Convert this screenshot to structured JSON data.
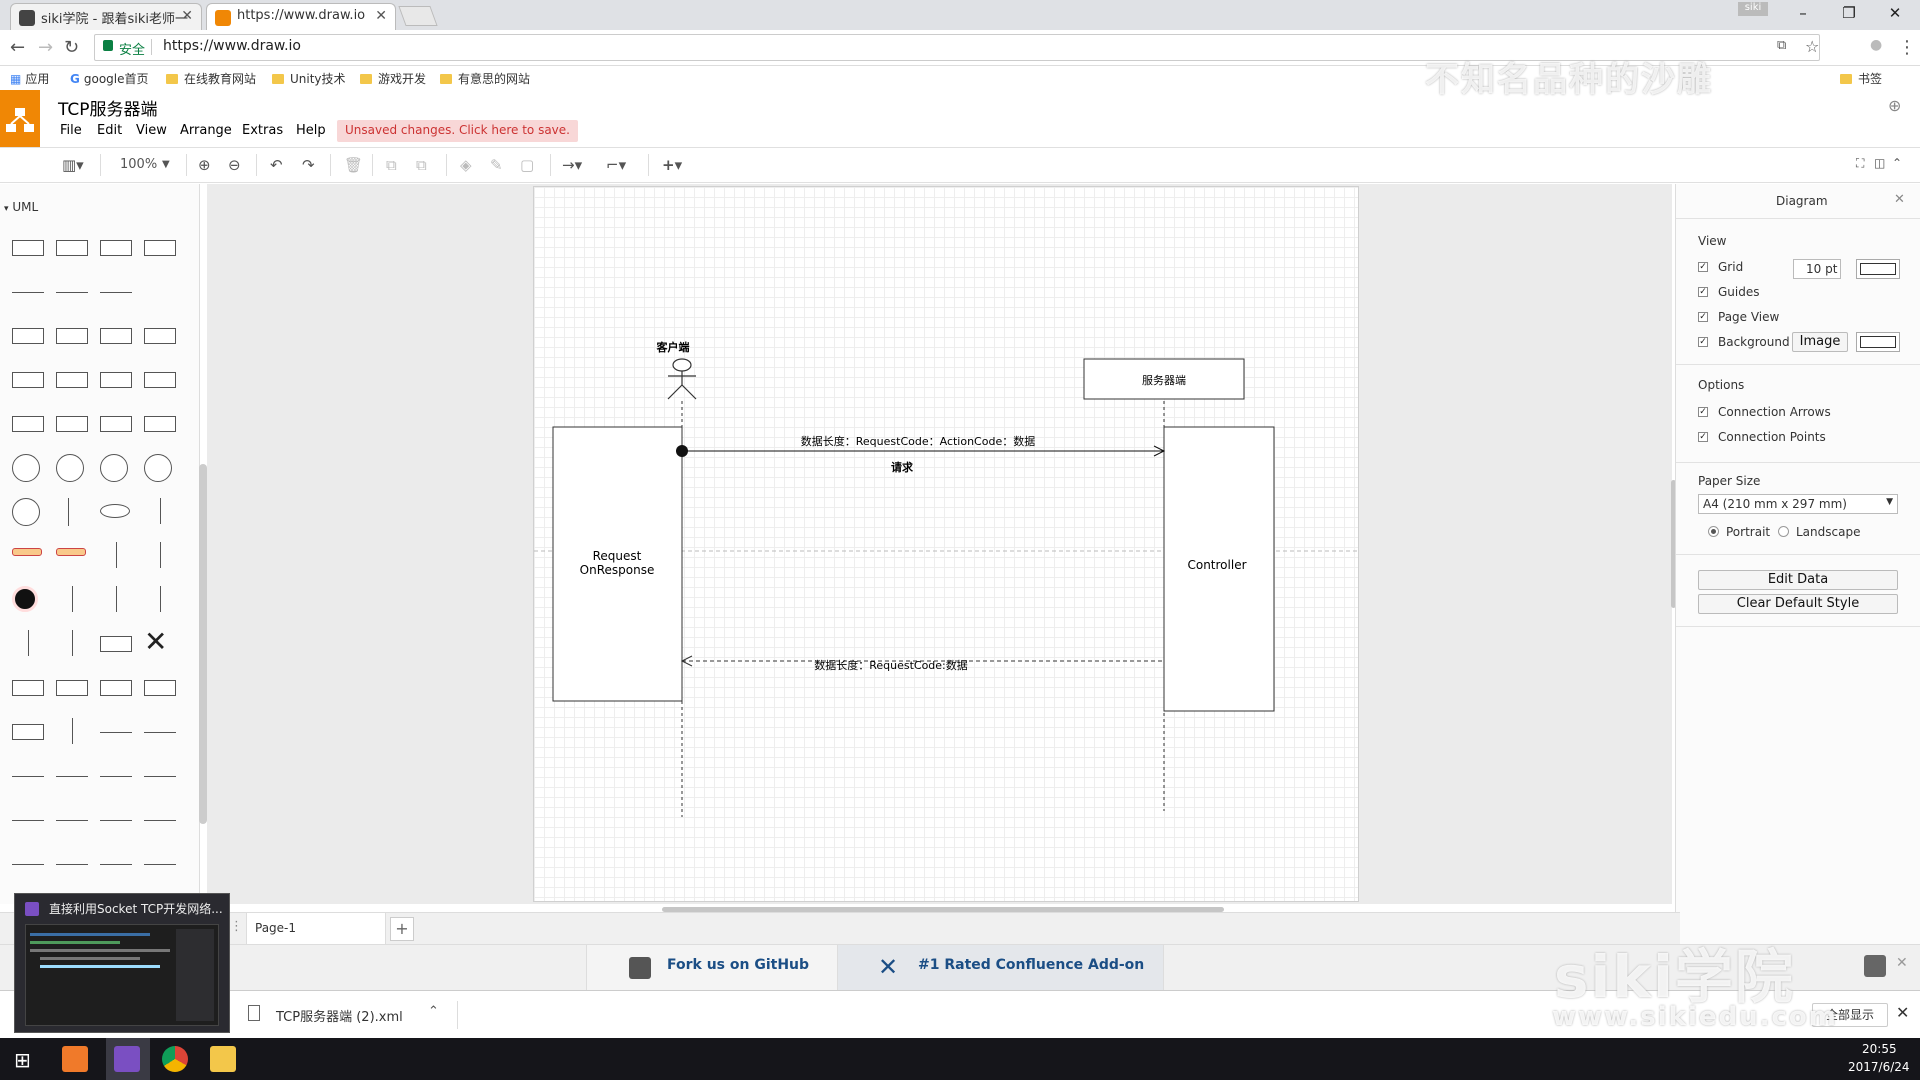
{
  "browser": {
    "tabs": [
      {
        "title": "siki学院 - 跟着siki老师一"
      },
      {
        "title": "https://www.draw.io"
      }
    ],
    "profile_badge": "siki",
    "secure_label": "安全",
    "url": "https://www.draw.io",
    "bookmarks": [
      {
        "label": "应用"
      },
      {
        "label": "google首页"
      },
      {
        "label": "在线教育网站"
      },
      {
        "label": "Unity技术"
      },
      {
        "label": "游戏开发"
      },
      {
        "label": "有意思的网站"
      },
      {
        "label": "书签"
      }
    ]
  },
  "app": {
    "document_title": "TCP服务器端",
    "menus": [
      "File",
      "Edit",
      "View",
      "Arrange",
      "Extras",
      "Help"
    ],
    "unsaved_notice": "Unsaved changes. Click here to save.",
    "zoom": "100%"
  },
  "sidebar": {
    "section_title": "UML"
  },
  "diagram": {
    "actor_label": "客户端",
    "server_label": "服务器端",
    "left_activation_text_1": "Request",
    "left_activation_text_2": "OnResponse",
    "right_activation_text": "Controller",
    "request_message": "数据长度：RequestCode：ActionCode：数据",
    "request_label": "请求",
    "response_message": "数据长度：RequestCode:数据"
  },
  "format_panel": {
    "title": "Diagram",
    "view_heading": "View",
    "grid_label": "Grid",
    "grid_size": "10 pt",
    "guides_label": "Guides",
    "page_view_label": "Page View",
    "background_label": "Background",
    "image_button": "Image",
    "options_heading": "Options",
    "connection_arrows_label": "Connection Arrows",
    "connection_points_label": "Connection Points",
    "paper_size_heading": "Paper Size",
    "paper_size_value": "A4 (210 mm x 297 mm)",
    "portrait_label": "Portrait",
    "landscape_label": "Landscape",
    "edit_data_button": "Edit Data",
    "clear_default_style_button": "Clear Default Style"
  },
  "page_tabs": {
    "page_name": "Page-1",
    "add_symbol": "+"
  },
  "footer": {
    "github_promo": "Fork us on GitHub",
    "confluence_promo": "#1 Rated Confluence Add-on"
  },
  "downloads": {
    "file_name": "TCP服务器端 (2).xml",
    "show_all": "全部显示"
  },
  "taskbar": {
    "thumbnail_title": "直接利用Socket TCP开发网络...",
    "time": "20:55",
    "date": "2017/6/24"
  },
  "watermarks": {
    "top_text": "不知名品种的沙雕",
    "brand": "siki学院",
    "site": "www.sikiedu.com"
  },
  "colors": {
    "drawio_orange": "#f08705",
    "unsaved_bg": "#f8d7d7",
    "unsaved_text": "#cc3333",
    "promo_text": "#1b4e85"
  }
}
